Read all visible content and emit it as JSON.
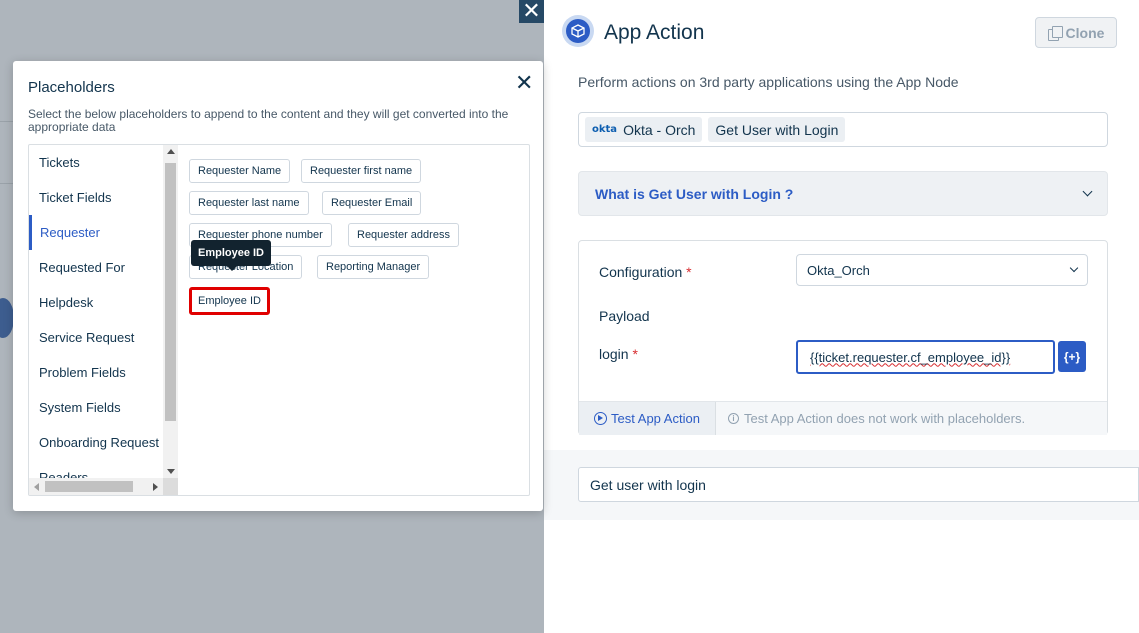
{
  "drawer": {
    "close_glyph": "✕",
    "title": "App Action",
    "clone_label": "Clone",
    "description": "Perform actions on 3rd party applications using the App Node",
    "app_logo": "okta",
    "app_name": "Okta - Orch",
    "action_name": "Get User with Login",
    "accordion_title": "What is Get User with Login ?",
    "configuration_label": "Configuration",
    "configuration_value": "Okta_Orch",
    "payload_label": "Payload",
    "login_label": "login",
    "login_value": "{{ticket.requester.cf_employee_id}}",
    "placeholder_button": "{+}",
    "test_button": "Test App Action",
    "test_note": "Test App Action does not work with placeholders.",
    "node_name_value": "Get user with login"
  },
  "modal": {
    "title": "Placeholders",
    "close_glyph": "✕",
    "description": "Select the below placeholders to append to the content and they will get converted into the appropriate data",
    "categories": [
      {
        "label": "Tickets"
      },
      {
        "label": "Ticket Fields"
      },
      {
        "label": "Requester"
      },
      {
        "label": "Requested For"
      },
      {
        "label": "Helpdesk"
      },
      {
        "label": "Service Request"
      },
      {
        "label": "Problem Fields"
      },
      {
        "label": "System Fields"
      },
      {
        "label": "Onboarding Request"
      },
      {
        "label": "Readers"
      }
    ],
    "active_category": "Requester",
    "placeholders": [
      {
        "label": "Requester Name"
      },
      {
        "label": "Requester first name"
      },
      {
        "label": "Requester last name"
      },
      {
        "label": "Requester Email"
      },
      {
        "label": "Requester phone number"
      },
      {
        "label": "Requester address"
      },
      {
        "label": "Requester Location"
      },
      {
        "label": "Reporting Manager"
      },
      {
        "label": "Employee ID"
      }
    ],
    "tooltip": "Employee ID"
  },
  "colors": {
    "accent": "#2c5cc5",
    "highlight": "#e00000",
    "required": "#d72d30"
  }
}
